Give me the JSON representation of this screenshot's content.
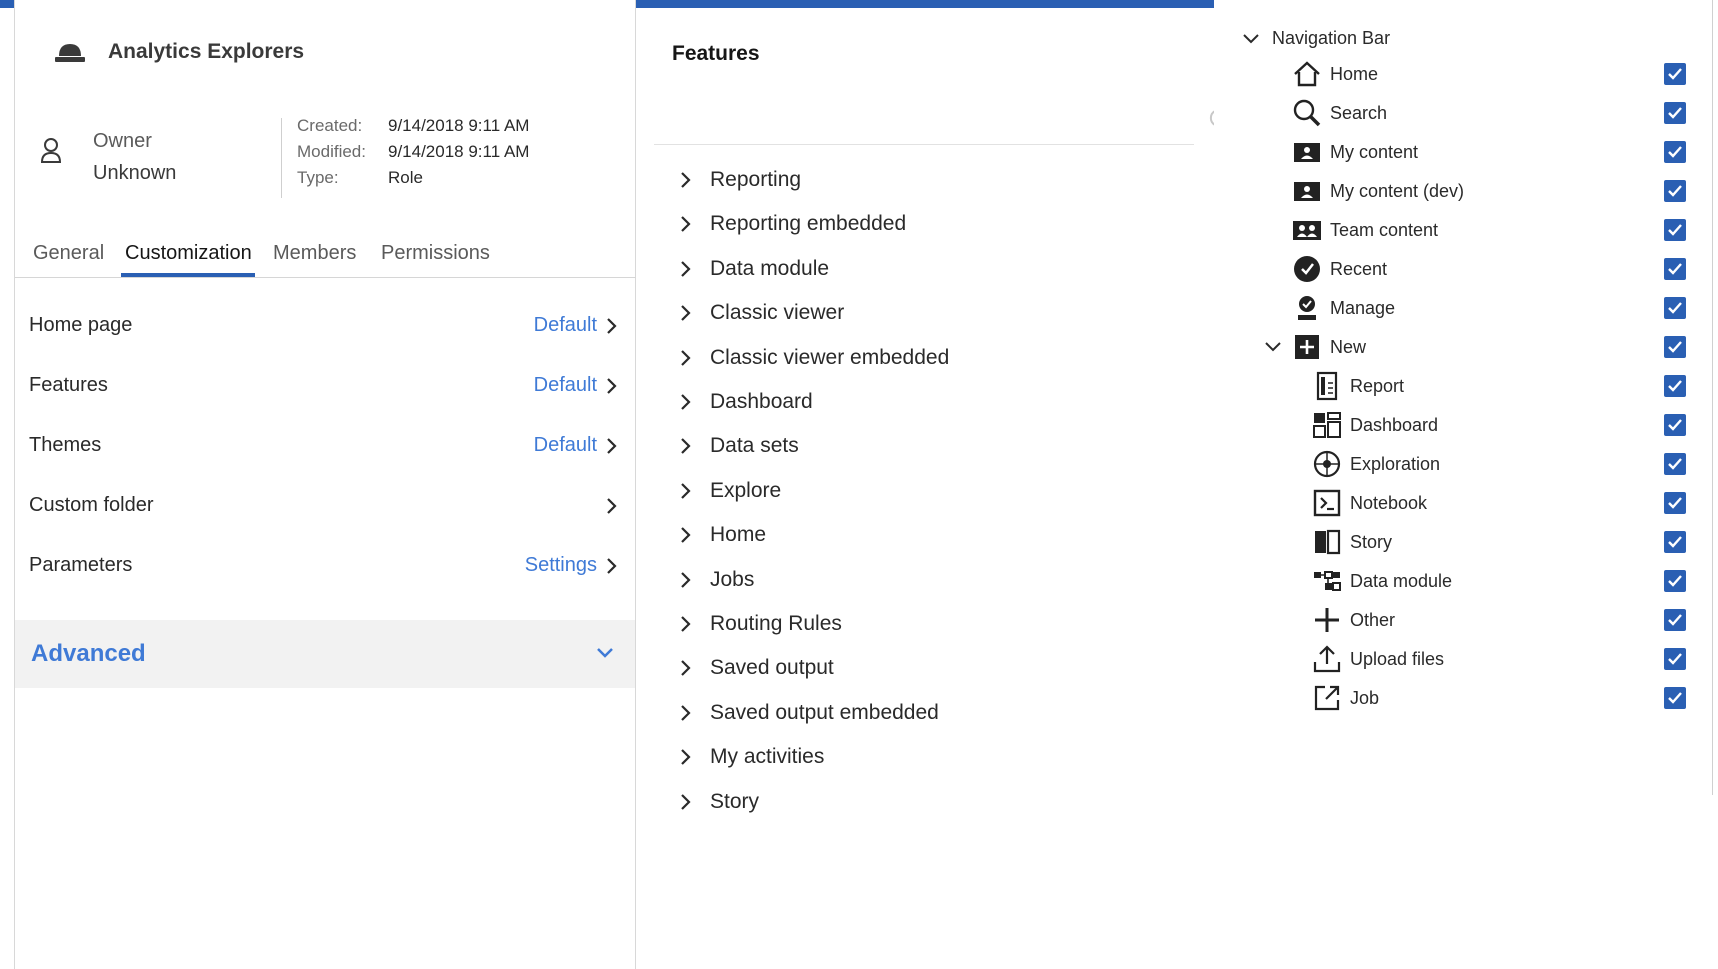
{
  "colors": {
    "accent": "#2a5fb3",
    "link": "#3f7ad6",
    "check": "#2a5fb3"
  },
  "props": {
    "title": "Analytics Explorers",
    "owner_label": "Owner",
    "owner_value": "Unknown",
    "meta": [
      {
        "key": "Created:",
        "value": "9/14/2018 9:11 AM"
      },
      {
        "key": "Modified:",
        "value": "9/14/2018 9:11 AM"
      },
      {
        "key": "Type:",
        "value": "Role"
      }
    ],
    "tabs": [
      {
        "label": "General"
      },
      {
        "label": "Customization",
        "active": true
      },
      {
        "label": "Members"
      },
      {
        "label": "Permissions"
      }
    ],
    "rows": [
      {
        "label": "Home page",
        "link": "Default"
      },
      {
        "label": "Features",
        "link": "Default"
      },
      {
        "label": "Themes",
        "link": "Default"
      },
      {
        "label": "Custom folder",
        "link": ""
      },
      {
        "label": "Parameters",
        "link": "Settings"
      }
    ],
    "advanced": "Advanced"
  },
  "features": {
    "title": "Features",
    "items": [
      "Reporting",
      "Reporting embedded",
      "Data module",
      "Classic viewer",
      "Classic viewer embedded",
      "Dashboard",
      "Data sets",
      "Explore",
      "Home",
      "Jobs",
      "Routing Rules",
      "Saved output",
      "Saved output embedded",
      "My activities",
      "Story"
    ]
  },
  "nav": {
    "header": "Navigation Bar",
    "items": [
      {
        "label": "Home",
        "icon": "home-icon",
        "checked": true
      },
      {
        "label": "Search",
        "icon": "search-icon",
        "checked": true
      },
      {
        "label": "My content",
        "icon": "my-content-icon",
        "checked": true
      },
      {
        "label": "My content (dev)",
        "icon": "my-content-dev-icon",
        "checked": true
      },
      {
        "label": "Team content",
        "icon": "team-content-icon",
        "checked": true
      },
      {
        "label": "Recent",
        "icon": "recent-icon",
        "checked": true
      },
      {
        "label": "Manage",
        "icon": "manage-icon",
        "checked": true
      },
      {
        "label": "New",
        "icon": "new-icon",
        "checked": true,
        "expanded": true
      },
      {
        "label": "Report",
        "icon": "report-icon",
        "checked": true,
        "child": true
      },
      {
        "label": "Dashboard",
        "icon": "dashboard-icon",
        "checked": true,
        "child": true
      },
      {
        "label": "Exploration",
        "icon": "exploration-icon",
        "checked": true,
        "child": true
      },
      {
        "label": "Notebook",
        "icon": "notebook-icon",
        "checked": true,
        "child": true
      },
      {
        "label": "Story",
        "icon": "story-icon",
        "checked": true,
        "child": true
      },
      {
        "label": "Data module",
        "icon": "data-module-icon",
        "checked": true,
        "child": true
      },
      {
        "label": "Other",
        "icon": "other-icon",
        "checked": true,
        "child": true
      },
      {
        "label": "Upload files",
        "icon": "upload-files-icon",
        "checked": true,
        "child": true
      },
      {
        "label": "Job",
        "icon": "job-icon",
        "checked": true,
        "child": true
      }
    ]
  }
}
